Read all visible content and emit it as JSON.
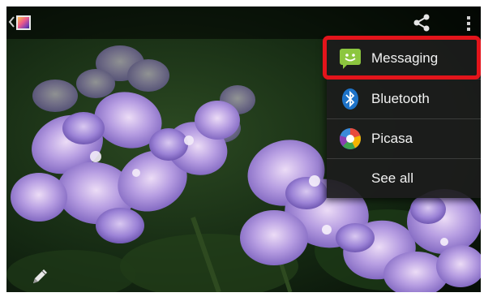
{
  "action_bar": {
    "up_icon": "chevron-left-icon",
    "app_icon": "gallery-icon",
    "share_icon": "share-icon",
    "overflow_icon": "overflow-menu-icon"
  },
  "share_menu": {
    "items": [
      {
        "label": "Messaging",
        "icon": "messaging-icon",
        "highlighted": true
      },
      {
        "label": "Bluetooth",
        "icon": "bluetooth-icon",
        "highlighted": false
      },
      {
        "label": "Picasa",
        "icon": "picasa-icon",
        "highlighted": false
      },
      {
        "label": "See all",
        "icon": null,
        "highlighted": false
      }
    ]
  },
  "bottom_bar": {
    "edit_icon": "pencil-icon"
  },
  "colors": {
    "highlight": "#e3141b",
    "menu_background": "#1c1c1c",
    "messaging_green": "#8cc63f"
  }
}
